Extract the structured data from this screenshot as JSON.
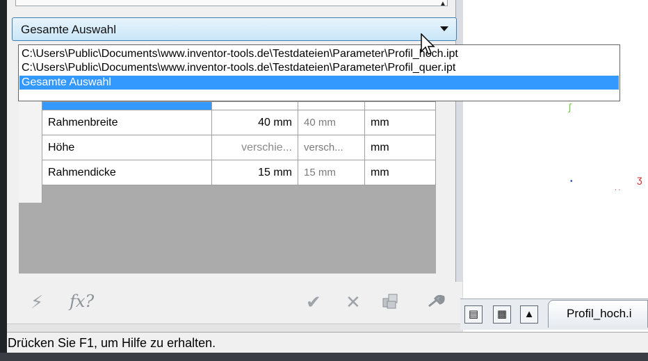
{
  "combo": {
    "selected": "Gesamte Auswahl",
    "arrow_icon": "chevron-down-icon"
  },
  "dropdown": {
    "items": [
      "C:\\Users\\Public\\Documents\\www.inventor-tools.de\\Testdateien\\Parameter\\Profil_hoch.ipt",
      "C:\\Users\\Public\\Documents\\www.inventor-tools.de\\Testdateien\\Parameter\\Profil_quer.ipt",
      "Gesamte Auswahl"
    ]
  },
  "grid": {
    "rows": [
      {
        "name": "Rahmenbreite",
        "value": "40 mm",
        "value2": "40 mm",
        "unit": "mm"
      },
      {
        "name": "Höhe",
        "value": "verschie...",
        "value2": "versch...",
        "unit": "mm"
      },
      {
        "name": "Rahmendicke",
        "value": "15 mm",
        "value2": "15 mm",
        "unit": "mm"
      }
    ]
  },
  "toolbar": {
    "icons": [
      "lightning-icon",
      "function-query-icon",
      "check-icon",
      "close-icon",
      "parts-icon",
      "wrench-icon"
    ],
    "fx_label": "fx?"
  },
  "tabs": {
    "document_tab": "Profil_hoch.i"
  },
  "status": {
    "text": "Drücken Sie F1, um Hilfe zu erhalten."
  },
  "colors": {
    "selection": "#3399ff",
    "combo_border": "#3c7fb1",
    "panel_bg": "#f0f0f0"
  }
}
